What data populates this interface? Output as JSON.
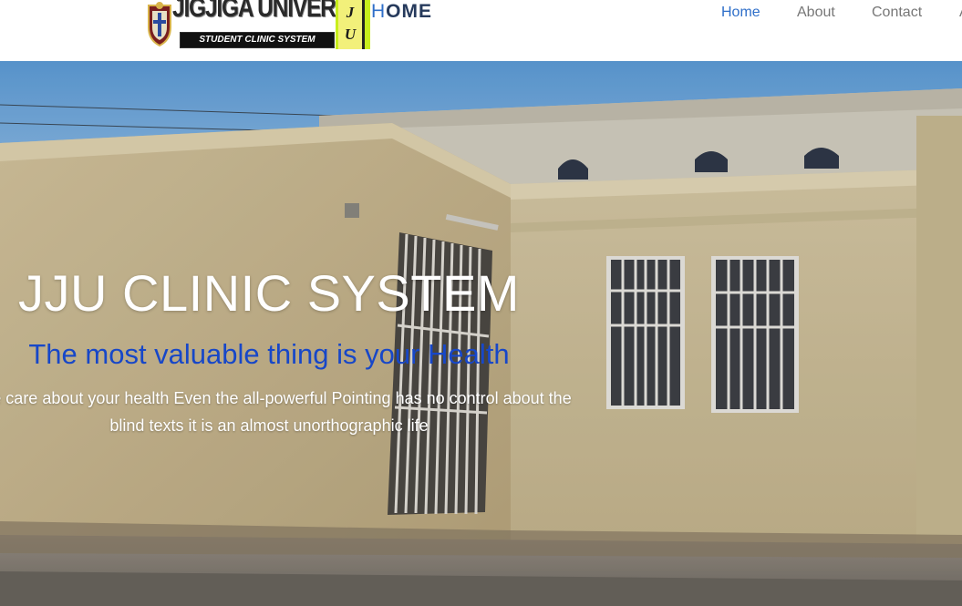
{
  "header": {
    "logo": {
      "university_name": "JIGJIGA UNIVERSITY",
      "tagline": "STUDENT CLINIC SYSTEM",
      "badge_text": "J U",
      "badge_colors": {
        "outer": "#c8ee1c",
        "inner": "#f2f07a"
      }
    },
    "page_title_first_letter": "H",
    "page_title_rest": "OME",
    "nav": [
      {
        "label": "Home",
        "active": true
      },
      {
        "label": "About",
        "active": false
      },
      {
        "label": "Contact",
        "active": false
      },
      {
        "label": "A",
        "active": false
      }
    ]
  },
  "hero": {
    "title": "JJU CLINIC SYSTEM",
    "subtitle": "The most valuable thing is your Health",
    "text_line1": "Take care about your health Even the all-powerful Pointing has no control about the",
    "text_line2": "blind texts it is an almost unorthographic life",
    "background_image": "clinic-building-photo"
  },
  "colors": {
    "accent_blue": "#2f6fc9",
    "subtitle_blue": "#1747c8",
    "nav_gray": "#777777",
    "title_dark": "#263a5c"
  }
}
